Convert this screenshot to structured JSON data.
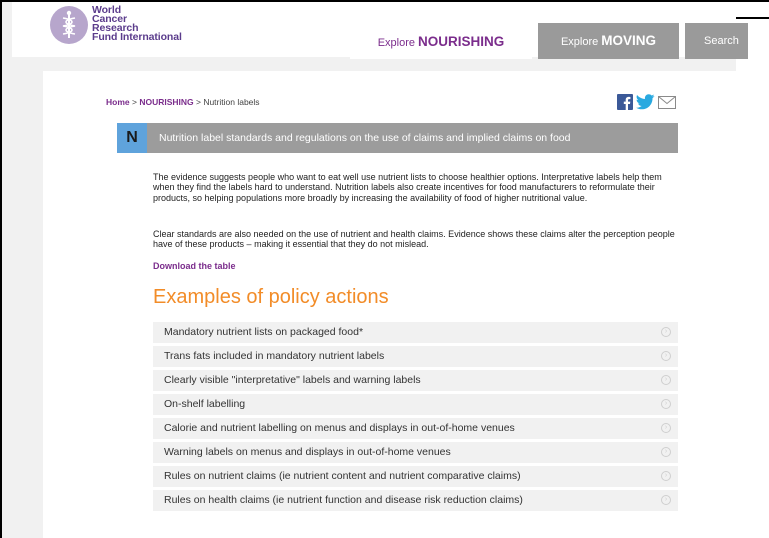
{
  "header": {
    "logo_lines": [
      "World",
      "Cancer",
      "Research",
      "Fund International"
    ],
    "tab_nourishing": {
      "prefix": "Explore",
      "strong": "NOURISHING"
    },
    "tab_moving": {
      "prefix": "Explore",
      "strong": "MOVING"
    },
    "search_label": "Search"
  },
  "breadcrumb": {
    "home": "Home",
    "sep1": " > ",
    "section": "NOURISHING",
    "sep2": " > ",
    "current": "Nutrition labels"
  },
  "title_bar": {
    "letter": "N",
    "text": "Nutrition label standards and regulations on the use of claims and implied claims on food"
  },
  "paragraphs": [
    "The evidence suggests people who want to eat well use nutrient lists to choose healthier options. Interpretative labels help them when they find the labels hard to understand. Nutrition labels also create incentives for food manufacturers to reformulate their products, so helping populations more broadly by increasing the availability of food of higher nutritional value.",
    "Clear standards are also needed on the use of nutrient and health claims. Evidence shows these claims alter the perception people have of these products – making it essential that they do not mislead."
  ],
  "download_link": "Download the table",
  "examples_heading": "Examples of policy actions",
  "actions": [
    "Mandatory nutrient lists on packaged food*",
    "Trans fats included in mandatory nutrient labels",
    "Clearly visible \"interpretative\" labels and warning labels",
    "On-shelf labelling",
    "Calorie and nutrient labelling on menus and displays in out-of-home venues",
    "Warning labels on menus and displays in out-of-home venues",
    "Rules on nutrient claims (ie nutrient content and nutrient comparative claims)",
    "Rules on health claims (ie nutrient function and disease risk reduction claims)"
  ],
  "colors": {
    "brand_purple": "#7b2d8c",
    "accent_orange": "#f28c28",
    "n_box_blue": "#5fa3dc",
    "bar_gray": "#9c9c9c"
  }
}
